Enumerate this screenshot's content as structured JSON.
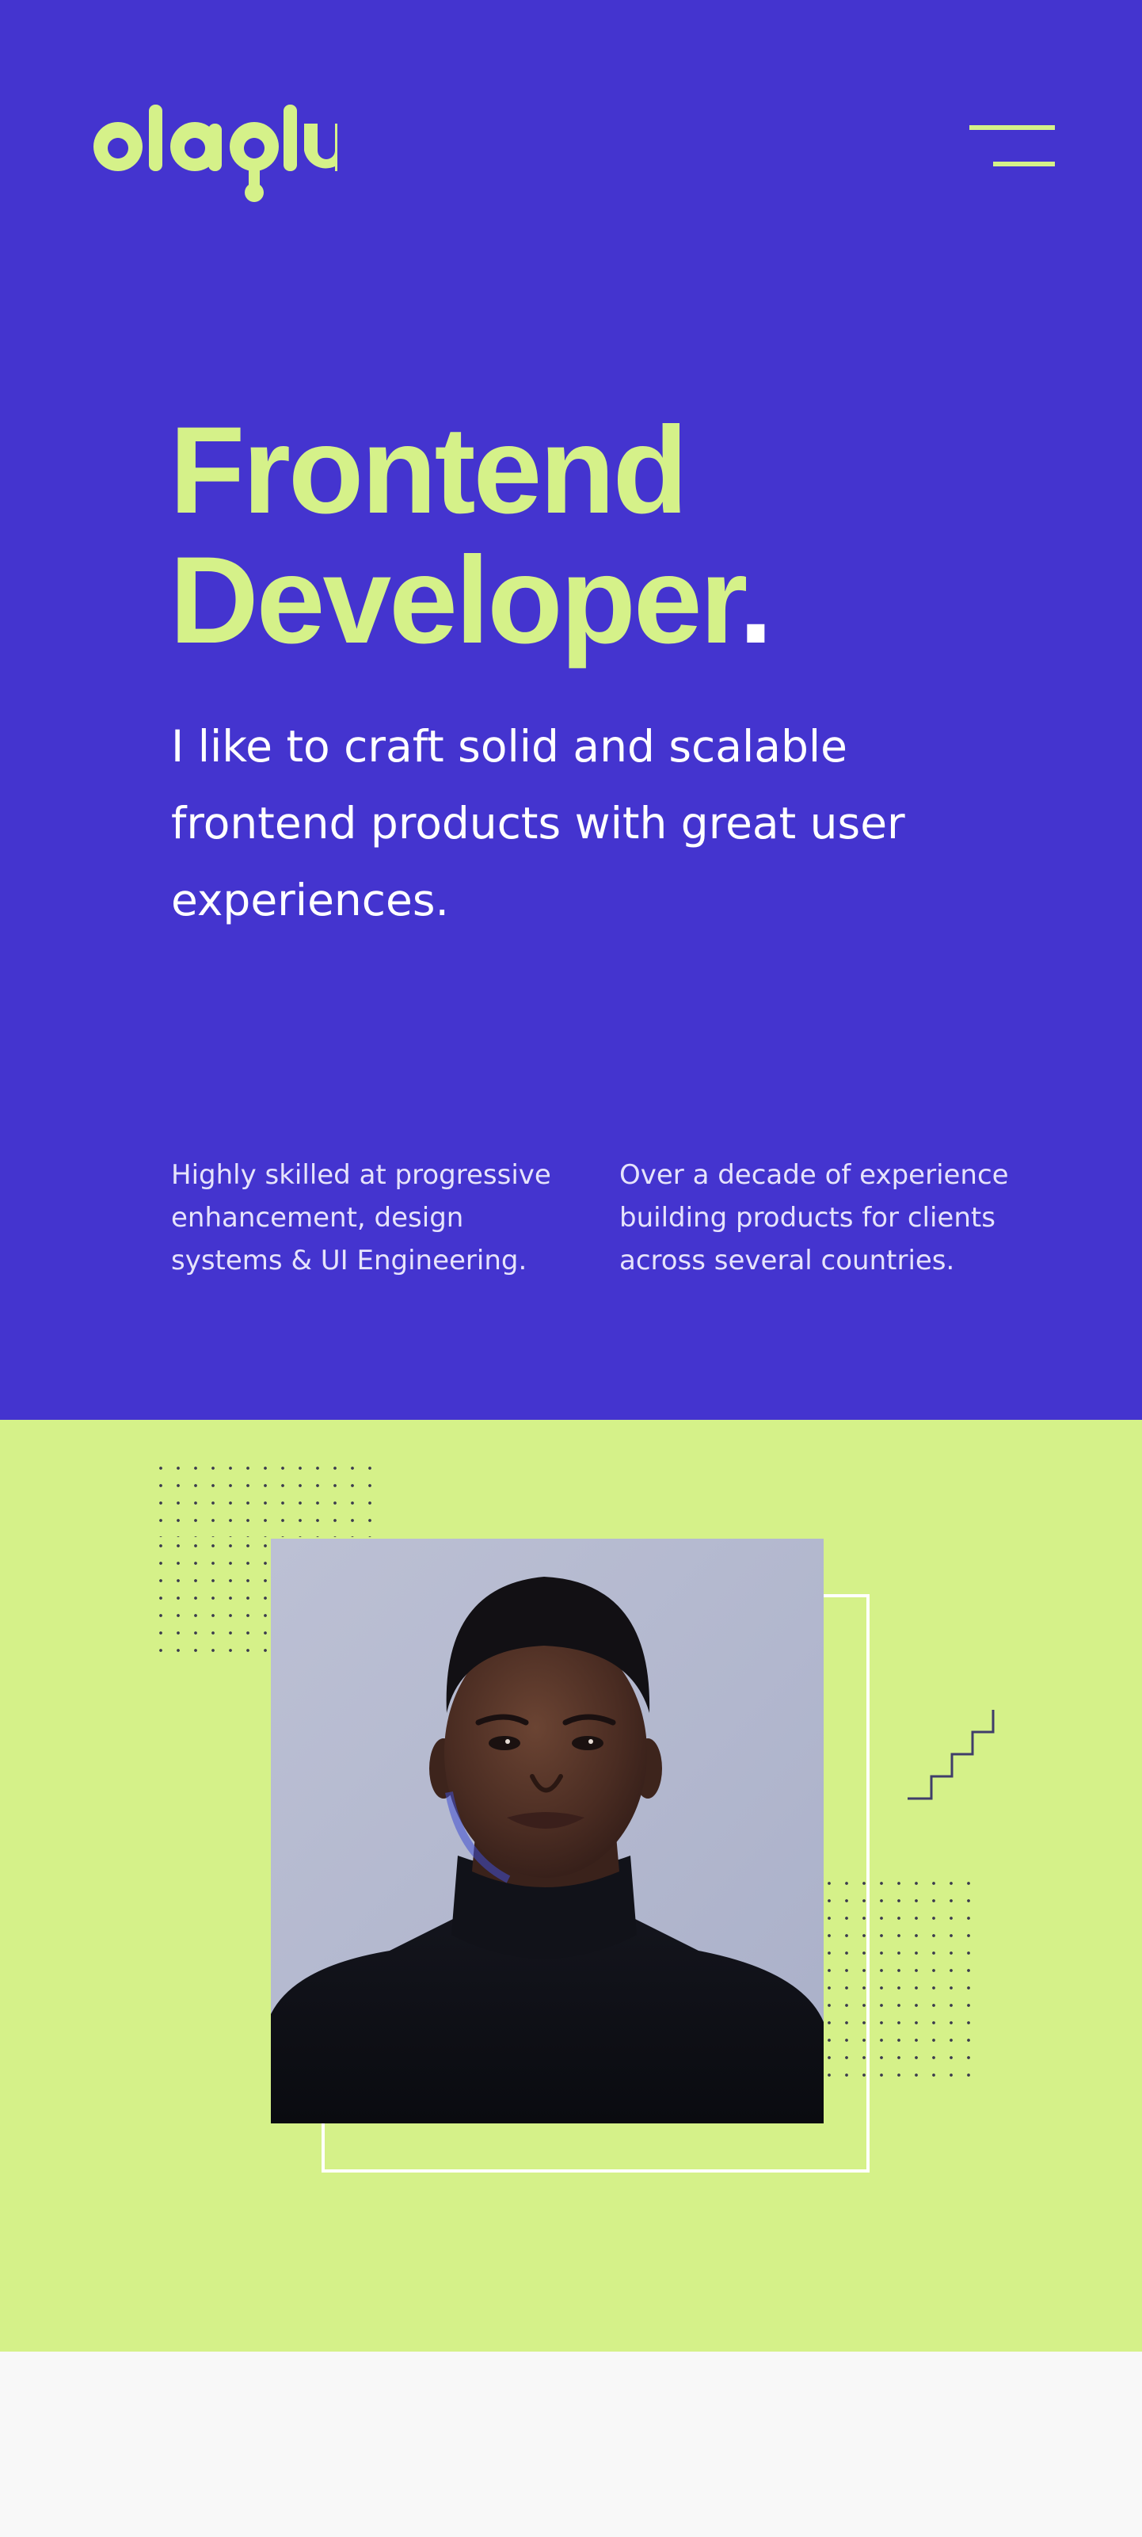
{
  "header": {
    "logo_text": "olaolu",
    "menu_icon": "hamburger-menu-icon"
  },
  "hero": {
    "headline_line1": "Frontend",
    "headline_line2": "Developer",
    "headline_dot": ".",
    "intro": "I like to craft solid and scalable frontend products with great user experiences.",
    "feature_1": "Highly skilled at progressive enhancement, design systems & UI Engineering.",
    "feature_2": "Over a decade of experience building products for clients across several countries."
  },
  "photo_section": {
    "portrait_icon": "portrait-photo",
    "decoration_icons": [
      "dot-grid-icon",
      "staircase-icon",
      "outline-frame"
    ]
  },
  "colors": {
    "brand_purple": "#4434cf",
    "brand_lime": "#d5f189",
    "text_white": "#ffffff",
    "footer_bg": "#f8f8f8"
  }
}
